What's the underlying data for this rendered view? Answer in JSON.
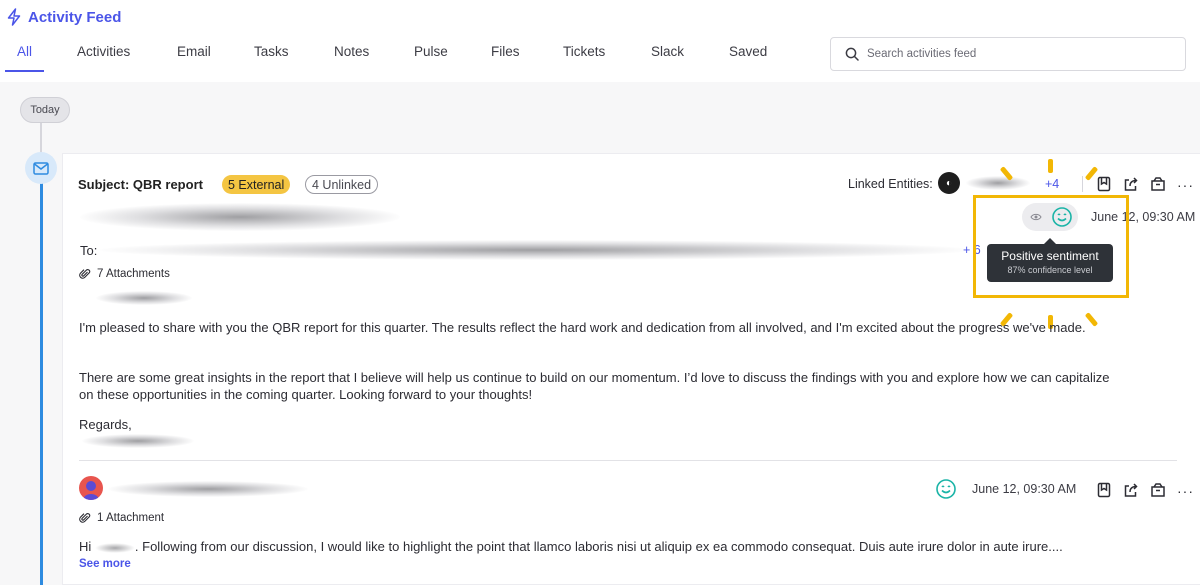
{
  "header": {
    "title": "Activity Feed"
  },
  "tabs": [
    {
      "label": "All",
      "active": true
    },
    {
      "label": "Activities"
    },
    {
      "label": "Email"
    },
    {
      "label": "Tasks"
    },
    {
      "label": "Notes"
    },
    {
      "label": "Pulse"
    },
    {
      "label": "Files"
    },
    {
      "label": "Tickets"
    },
    {
      "label": "Slack"
    },
    {
      "label": "Saved"
    }
  ],
  "search": {
    "placeholder": "Search activities feed",
    "value": ""
  },
  "timeline": {
    "day_label": "Today"
  },
  "email": {
    "subject": "Subject: QBR report",
    "external_badge": "5 External",
    "unlinked_badge": "4 Unlinked",
    "linked_entities_label": "Linked Entities:",
    "linked_more": "+4",
    "date": "June 12, 09:30 AM",
    "to_label": "To:",
    "to_more": "+ 6",
    "attachments": "7 Attachments",
    "body": [
      "I'm pleased to share with you the QBR report for this quarter. The results reflect the hard work and dedication from all involved, and I'm excited about the progress we've made.",
      "There are some great insights in the report that I believe will help us continue to build on our momentum. I’d love to discuss the findings with you and explore how we can capitalize on these opportunities in the coming quarter. Looking forward to your thoughts!"
    ],
    "signoff": "Regards,",
    "tooltip": {
      "title": "Positive sentiment",
      "subtitle": "87% confidence level"
    }
  },
  "reply": {
    "date": "June 12, 09:30 AM",
    "attachments": "1 Attachment",
    "greeting": "Hi",
    "body": ". Following from our discussion, I would like to highlight the point that llamco laboris nisi ut aliquip ex ea commodo consequat. Duis aute irure dolor in  aute irure....",
    "see_more": "See more"
  },
  "colors": {
    "accent": "#4b55e8",
    "timeline_blue": "#2e8be0",
    "external_badge": "#f4c542",
    "highlight": "#f2b705",
    "sentiment_positive": "#1bb4a7",
    "tooltip_bg": "#2e3238"
  },
  "icons": {
    "title": "bolt-icon",
    "search": "search-icon",
    "timeline": "mail-icon",
    "attachment": "paperclip-icon",
    "sentiment": "smile-icon",
    "view": "eye-icon",
    "actions": [
      "bookmark-icon",
      "share-icon",
      "archive-icon",
      "more-icon"
    ]
  }
}
